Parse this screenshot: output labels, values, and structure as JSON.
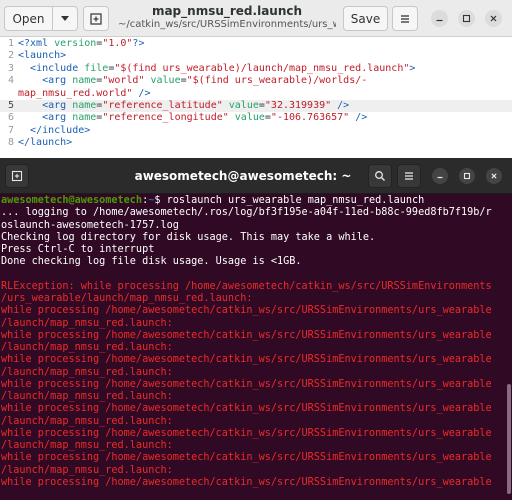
{
  "editor": {
    "title": "map_nmsu_red.launch",
    "subtitle": "~/catkin_ws/src/URSSimEnvironments/urs_wearabl…",
    "open_label": "Open",
    "save_label": "Save",
    "icons": [
      "dropdown-arrow-icon",
      "new-tab-icon",
      "hamburger-menu-icon",
      "minimize-icon",
      "maximize-icon",
      "close-icon"
    ],
    "lines": [
      {
        "n": "1",
        "parts": [
          [
            "tag",
            "<?xml "
          ],
          [
            "attr",
            "version"
          ],
          [
            "op",
            "="
          ],
          [
            "str",
            "\"1.0\""
          ],
          [
            "tag",
            "?>"
          ]
        ]
      },
      {
        "n": "2",
        "parts": [
          [
            "tag",
            "<launch>"
          ]
        ]
      },
      {
        "n": "3",
        "parts": [
          [
            "op",
            "  "
          ],
          [
            "tag",
            "<include "
          ],
          [
            "attr",
            "file"
          ],
          [
            "op",
            "="
          ],
          [
            "str",
            "\"$(find urs_wearable)/launch/map_nmsu_red.launch\""
          ],
          [
            "tag",
            ">"
          ]
        ]
      },
      {
        "n": "4",
        "parts": [
          [
            "op",
            "    "
          ],
          [
            "tag",
            "<arg "
          ],
          [
            "attr",
            "name"
          ],
          [
            "op",
            "="
          ],
          [
            "str",
            "\"world\" "
          ],
          [
            "attr",
            "value"
          ],
          [
            "op",
            "="
          ],
          [
            "str",
            "\"$(find urs_wearable)/worlds/-"
          ]
        ]
      },
      {
        "n": "",
        "parts": [
          [
            "str",
            "map_nmsu_red.world\" "
          ],
          [
            "tag",
            "/>"
          ]
        ]
      },
      {
        "n": "5",
        "parts": [
          [
            "op",
            "    "
          ],
          [
            "tag",
            "<arg "
          ],
          [
            "attr",
            "name"
          ],
          [
            "op",
            "="
          ],
          [
            "str",
            "\"reference_latitude\" "
          ],
          [
            "attr",
            "value"
          ],
          [
            "op",
            "="
          ],
          [
            "str",
            "\"32.319939\" "
          ],
          [
            "tag",
            "/>"
          ]
        ]
      },
      {
        "n": "6",
        "parts": [
          [
            "op",
            "    "
          ],
          [
            "tag",
            "<arg "
          ],
          [
            "attr",
            "name"
          ],
          [
            "op",
            "="
          ],
          [
            "str",
            "\"reference_longitude\" "
          ],
          [
            "attr",
            "value"
          ],
          [
            "op",
            "="
          ],
          [
            "str",
            "\"-106.763657\" "
          ],
          [
            "tag",
            "/>"
          ]
        ]
      },
      {
        "n": "7",
        "parts": [
          [
            "op",
            "  "
          ],
          [
            "tag",
            "</include>"
          ]
        ]
      },
      {
        "n": "8",
        "parts": [
          [
            "tag",
            "</launch>"
          ]
        ]
      }
    ]
  },
  "terminal": {
    "title": "awesometech@awesometech: ~",
    "icons": [
      "new-tab-icon",
      "search-icon",
      "hamburger-menu-icon",
      "minimize-icon",
      "maximize-icon",
      "close-icon"
    ],
    "prompt": {
      "user": "awesometech@awesometech",
      "path": "~",
      "sep": ":",
      "sym": "$ ",
      "command": "roslaunch urs_wearable map_nmsu_red.launch"
    },
    "lines": [
      {
        "kind": "normal",
        "text": "... logging to /home/awesometech/.ros/log/bf3f195e-a04f-11ed-b88c-99ed8fb7f19b/r"
      },
      {
        "kind": "normal",
        "text": "oslaunch-awesometech-1757.log"
      },
      {
        "kind": "normal",
        "text": "Checking log directory for disk usage. This may take a while."
      },
      {
        "kind": "normal",
        "text": "Press Ctrl-C to interrupt"
      },
      {
        "kind": "normal",
        "text": "Done checking log file disk usage. Usage is <1GB."
      },
      {
        "kind": "blank",
        "text": ""
      },
      {
        "kind": "err",
        "text": "RLException: while processing /home/awesometech/catkin_ws/src/URSSimEnvironments"
      },
      {
        "kind": "err",
        "text": "/urs_wearable/launch/map_nmsu_red.launch:"
      },
      {
        "kind": "err",
        "text": "while processing /home/awesometech/catkin_ws/src/URSSimEnvironments/urs_wearable"
      },
      {
        "kind": "err",
        "text": "/launch/map_nmsu_red.launch:"
      },
      {
        "kind": "err",
        "text": "while processing /home/awesometech/catkin_ws/src/URSSimEnvironments/urs_wearable"
      },
      {
        "kind": "err",
        "text": "/launch/map_nmsu_red.launch:"
      },
      {
        "kind": "err",
        "text": "while processing /home/awesometech/catkin_ws/src/URSSimEnvironments/urs_wearable"
      },
      {
        "kind": "err",
        "text": "/launch/map_nmsu_red.launch:"
      },
      {
        "kind": "err",
        "text": "while processing /home/awesometech/catkin_ws/src/URSSimEnvironments/urs_wearable"
      },
      {
        "kind": "err",
        "text": "/launch/map_nmsu_red.launch:"
      },
      {
        "kind": "err",
        "text": "while processing /home/awesometech/catkin_ws/src/URSSimEnvironments/urs_wearable"
      },
      {
        "kind": "err",
        "text": "/launch/map_nmsu_red.launch:"
      },
      {
        "kind": "err",
        "text": "while processing /home/awesometech/catkin_ws/src/URSSimEnvironments/urs_wearable"
      },
      {
        "kind": "err",
        "text": "/launch/map_nmsu_red.launch:"
      },
      {
        "kind": "err",
        "text": "while processing /home/awesometech/catkin_ws/src/URSSimEnvironments/urs_wearable"
      },
      {
        "kind": "err",
        "text": "/launch/map_nmsu_red.launch:"
      },
      {
        "kind": "err",
        "text": "while processing /home/awesometech/catkin_ws/src/URSSimEnvironments/urs_wearable"
      }
    ]
  },
  "colors": {
    "terminal_bg": "#300a24",
    "prompt_user": "#4e9a06",
    "prompt_path": "#3465a4",
    "error_text": "#ef2929",
    "xml_tag": "#1a5fb4",
    "xml_attr": "#26a269",
    "xml_string": "#c01c28"
  }
}
